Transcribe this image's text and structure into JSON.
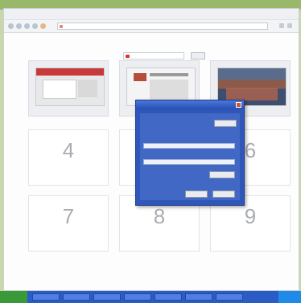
{
  "menubar": {
    "items": []
  },
  "address_bar": {
    "value": ""
  },
  "search": {
    "placeholder": "",
    "button_label": ""
  },
  "speed_dial": {
    "thumbnails": [
      {
        "caption": "",
        "colors": [
          "#c83a3a",
          "#e8e8e8"
        ]
      },
      {
        "caption": "",
        "colors": [
          "#d9dde3",
          "#f4f4f4"
        ]
      },
      {
        "caption": "",
        "colors": [
          "#5a6b8c",
          "#c0664a"
        ]
      }
    ],
    "empty_slots": [
      {
        "number": "4",
        "label": ""
      },
      {
        "number": "6",
        "label": ""
      },
      {
        "number": "7",
        "label": ""
      },
      {
        "number": "8",
        "label": ""
      },
      {
        "number": "9",
        "label": ""
      }
    ]
  },
  "dialog": {
    "title": "",
    "description": "",
    "button_top": "",
    "field1_label": "",
    "field1_value": "",
    "field2_label": "",
    "field2_value": "",
    "button_mid": "",
    "ok_label": "",
    "cancel_label": ""
  },
  "footer": {
    "left_link": "",
    "right_link": ""
  },
  "taskbar": {
    "start_label": ""
  },
  "colors": {
    "accent": "#2f56b9",
    "taskbar": "#2b5cc6",
    "start": "#3a9a3a"
  }
}
